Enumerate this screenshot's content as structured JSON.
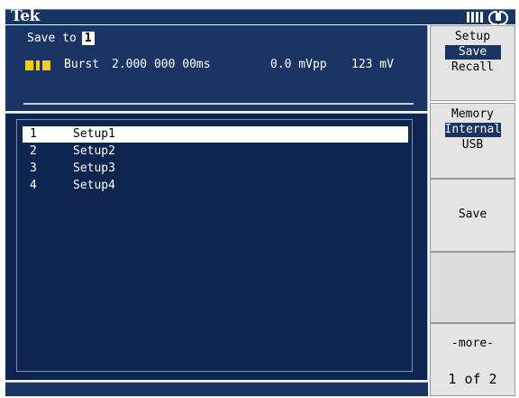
{
  "status_bar": {
    "logo": "Tek",
    "icons": [
      "usb-icon",
      "network-icon"
    ]
  },
  "header": {
    "save_to_label": "Save to",
    "save_to_value": "1",
    "waveform_icon": "burst-waveform-icon",
    "burst_mode": "Burst",
    "burst_period": "2.000 000 00ms",
    "amplitude": "0.0 mVpp",
    "offset": "123 mV"
  },
  "setups": [
    {
      "number": "1",
      "name": "Setup1",
      "selected": true
    },
    {
      "number": "2",
      "name": "Setup2",
      "selected": false
    },
    {
      "number": "3",
      "name": "Setup3",
      "selected": false
    },
    {
      "number": "4",
      "name": "Setup4",
      "selected": false
    }
  ],
  "menu": {
    "setup_title": "Setup",
    "setup_options": [
      "Save",
      "Recall"
    ],
    "setup_active": "Save",
    "memory_title": "Memory",
    "memory_options": [
      "Internal",
      "USB"
    ],
    "memory_active": "Internal",
    "save_label": "Save",
    "blank_label": "",
    "more_label": "-more-",
    "page_label": "1 of 2"
  },
  "colors": {
    "panel_bg": "#1a3463",
    "list_bg": "#0e2451",
    "accent_yellow": "#f5d000",
    "menu_bg": "#e4e4e4"
  }
}
